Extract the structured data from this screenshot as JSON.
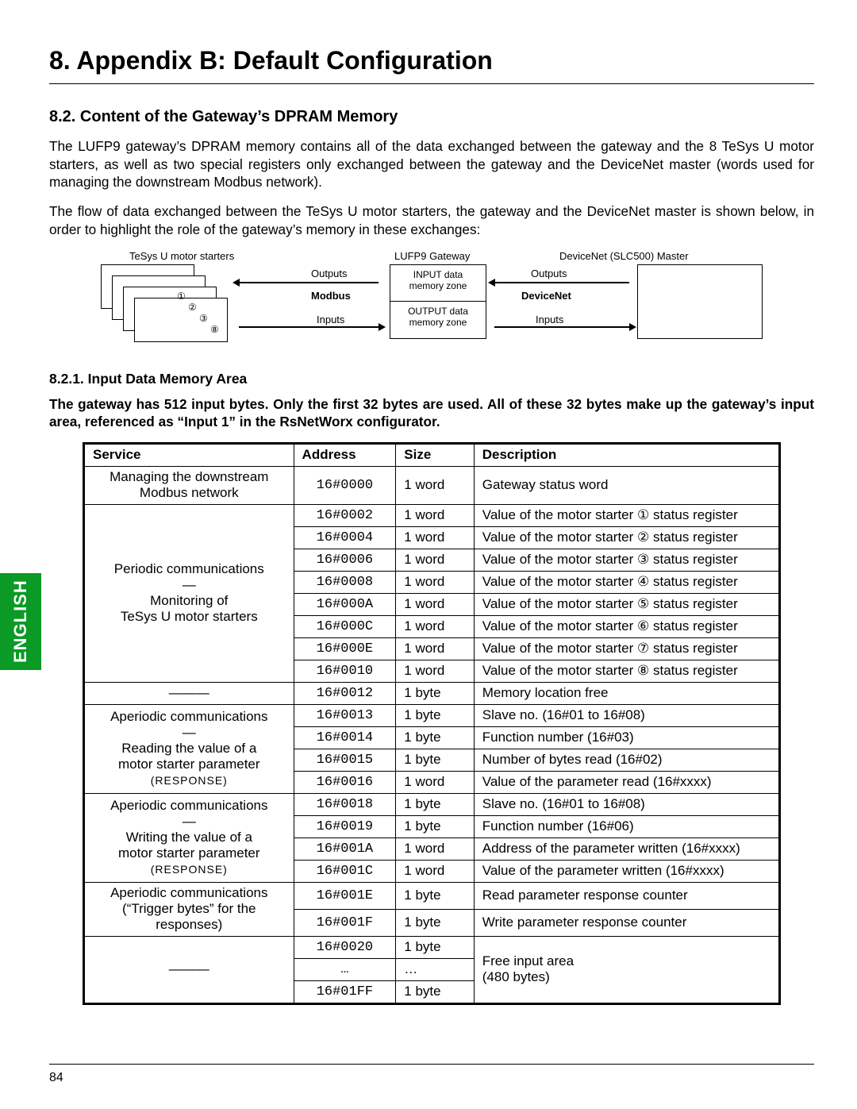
{
  "sidebar": {
    "language": "ENGLISH"
  },
  "title": "8. Appendix B: Default Configuration",
  "section": "8.2. Content of the Gateway’s DPRAM Memory",
  "para1": "The LUFP9 gateway’s DPRAM memory contains all of the data exchanged between the gateway and the 8 TeSys U motor starters, as well as two special registers only exchanged between the gateway and the DeviceNet master (words used for managing the downstream Modbus network).",
  "para2": "The flow of data exchanged between the TeSys U motor starters, the gateway and the DeviceNet master is shown below, in order to highlight the role of the gateway’s memory in these exchanges:",
  "diagram": {
    "left_label": "TeSys U motor starters",
    "mid_label": "LUFP9 Gateway",
    "right_label": "DeviceNet (SLC500) Master",
    "outputs": "Outputs",
    "inputs": "Inputs",
    "modbus": "Modbus",
    "devicenet": "DeviceNet",
    "mem_in": "INPUT data memory zone",
    "mem_out": "OUTPUT data memory zone",
    "n1": "①",
    "n2": "②",
    "n3": "③",
    "n8": "⑧"
  },
  "sub": "8.2.1. Input Data Memory Area",
  "para3": "The gateway has 512 input bytes. Only the first 32 bytes are used. All of these 32 bytes make up the gateway’s input area, referenced as “Input 1” in the RsNetWorx configurator.",
  "headers": {
    "service": "Service",
    "address": "Address",
    "size": "Size",
    "description": "Description"
  },
  "svc": {
    "g0": "Managing the downstream Modbus network",
    "g1a": "Periodic communications",
    "g1b": "—",
    "g1c": "Monitoring of",
    "g1d": "TeSys U motor starters",
    "g2": "———",
    "g3a": "Aperiodic communications",
    "g3b": "—",
    "g3c": "Reading the value of a",
    "g3d": "motor starter parameter",
    "g3e": "(RESPONSE)",
    "g4a": "Aperiodic communications",
    "g4b": "—",
    "g4c": "Writing the value of a",
    "g4d": "motor starter parameter",
    "g4e": "(RESPONSE)",
    "g5a": "Aperiodic communications",
    "g5b": "(“Trigger bytes” for the responses)",
    "g6": "———"
  },
  "rows": [
    {
      "addr": "16#0000",
      "size": "1 word",
      "desc": "Gateway status word"
    },
    {
      "addr": "16#0002",
      "size": "1 word",
      "desc": "Value of the motor starter ① status register"
    },
    {
      "addr": "16#0004",
      "size": "1 word",
      "desc": "Value of the motor starter ② status register"
    },
    {
      "addr": "16#0006",
      "size": "1 word",
      "desc": "Value of the motor starter ③ status register"
    },
    {
      "addr": "16#0008",
      "size": "1 word",
      "desc": "Value of the motor starter ④ status register"
    },
    {
      "addr": "16#000A",
      "size": "1 word",
      "desc": "Value of the motor starter ⑤ status register"
    },
    {
      "addr": "16#000C",
      "size": "1 word",
      "desc": "Value of the motor starter ⑥ status register"
    },
    {
      "addr": "16#000E",
      "size": "1 word",
      "desc": "Value of the motor starter ⑦ status register"
    },
    {
      "addr": "16#0010",
      "size": "1 word",
      "desc": "Value of the motor starter ⑧ status register"
    },
    {
      "addr": "16#0012",
      "size": "1 byte",
      "desc": "Memory location free"
    },
    {
      "addr": "16#0013",
      "size": "1 byte",
      "desc": "Slave no. (16#01 to 16#08)"
    },
    {
      "addr": "16#0014",
      "size": "1 byte",
      "desc": "Function number (16#03)"
    },
    {
      "addr": "16#0015",
      "size": "1 byte",
      "desc": "Number of bytes read (16#02)"
    },
    {
      "addr": "16#0016",
      "size": "1 word",
      "desc": "Value of the parameter read (16#xxxx)"
    },
    {
      "addr": "16#0018",
      "size": "1 byte",
      "desc": "Slave no. (16#01 to 16#08)"
    },
    {
      "addr": "16#0019",
      "size": "1 byte",
      "desc": "Function number (16#06)"
    },
    {
      "addr": "16#001A",
      "size": "1 word",
      "desc": "Address of the parameter written (16#xxxx)"
    },
    {
      "addr": "16#001C",
      "size": "1 word",
      "desc": "Value of the parameter written (16#xxxx)"
    },
    {
      "addr": "16#001E",
      "size": "1 byte",
      "desc": "Read parameter response counter"
    },
    {
      "addr": "16#001F",
      "size": "1 byte",
      "desc": "Write parameter response counter"
    },
    {
      "addr": "16#0020",
      "size": "1 byte",
      "desc": "Free input area"
    },
    {
      "addr": "…",
      "size": "…",
      "desc": "(480 bytes)"
    },
    {
      "addr": "16#01FF",
      "size": "1 byte",
      "desc": ""
    }
  ],
  "page": "84"
}
